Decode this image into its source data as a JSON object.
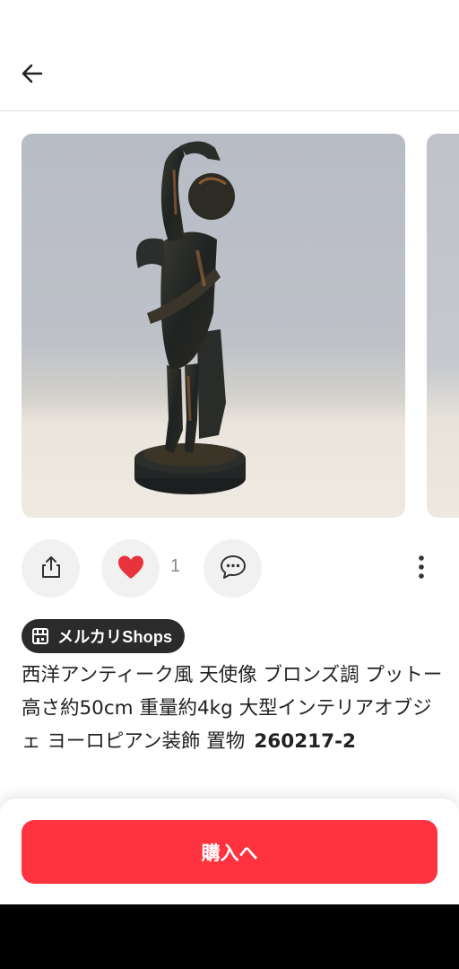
{
  "header": {
    "back_icon": "arrow-left-icon"
  },
  "gallery": {
    "photos": [
      {
        "subject": "bronze cherub statue on round base"
      },
      {
        "subject": "next photo preview"
      }
    ]
  },
  "actions": {
    "share_icon": "share-icon",
    "like_icon": "heart-icon",
    "like_count": "1",
    "comment_icon": "comment-icon",
    "more_icon": "more-vertical-icon",
    "like_color": "#e8323c"
  },
  "badge": {
    "label": "メルカリShops",
    "icon": "shop-icon"
  },
  "item": {
    "title": "西洋アンティーク風 天使像 ブロンズ調 プットー 高さ約50cm 重量約4kg 大型インテリアオブジェ ヨーロピアン装飾 置物",
    "code": "260217-2"
  },
  "purchase": {
    "button_label": "購入へ",
    "button_color": "#ff333f"
  }
}
